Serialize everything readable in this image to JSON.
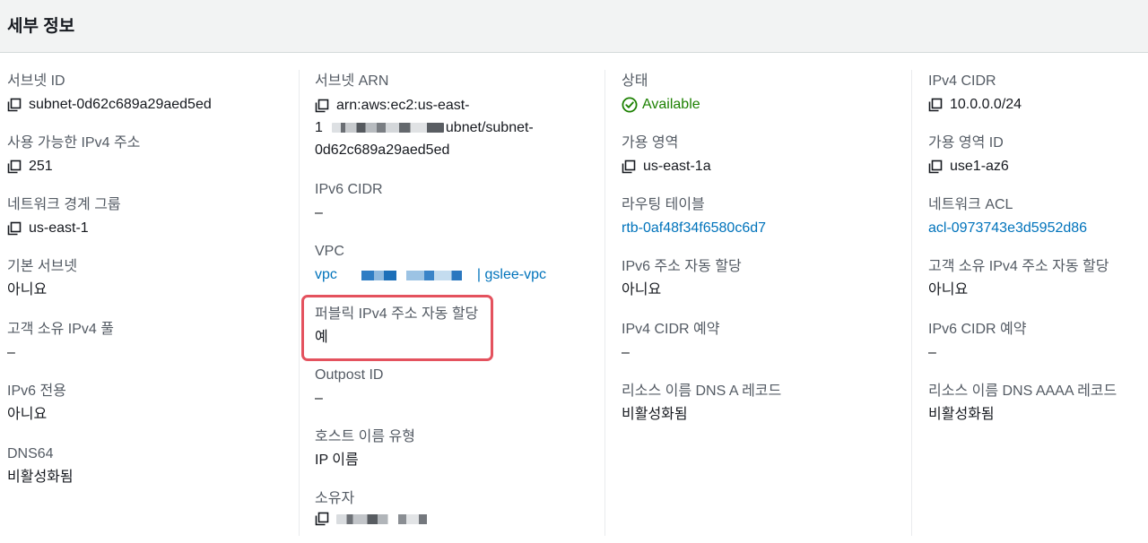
{
  "header": {
    "title": "세부 정보"
  },
  "columns": [
    [
      {
        "key": "subnet_id",
        "label": "서브넷 ID",
        "value": "subnet-0d62c689a29aed5ed",
        "copy": true
      },
      {
        "key": "available_ipv4",
        "label": "사용 가능한 IPv4 주소",
        "value": "251",
        "copy": true
      },
      {
        "key": "network_border_group",
        "label": "네트워크 경계 그룹",
        "value": "us-east-1",
        "copy": true
      },
      {
        "key": "default_subnet",
        "label": "기본 서브넷",
        "value": "아니요"
      },
      {
        "key": "customer_owned_ipv4_pool",
        "label": "고객 소유 IPv4 풀",
        "value": "–"
      },
      {
        "key": "ipv6_only",
        "label": "IPv6 전용",
        "value": "아니요"
      },
      {
        "key": "dns64",
        "label": "DNS64",
        "value": "비활성화됨"
      }
    ],
    [
      {
        "key": "subnet_arn",
        "label": "서브넷 ARN",
        "value_line1": "arn:aws:ec2:us-east-",
        "value_line2_prefix": "1",
        "value_line2_suffix": "ubnet/subnet-",
        "value_line3": "0d62c689a29aed5ed",
        "copy": true
      },
      {
        "key": "ipv6_cidr",
        "label": "IPv6 CIDR",
        "value": "–"
      },
      {
        "key": "vpc",
        "label": "VPC",
        "value_prefix": "vpc",
        "value_suffix": "| gslee-vpc",
        "link": true
      },
      {
        "key": "auto_assign_public_ipv4",
        "label": "퍼블릭 IPv4 주소 자동 할당",
        "value": "예"
      },
      {
        "key": "outpost_id",
        "label": "Outpost ID",
        "value": "–"
      },
      {
        "key": "hostname_type",
        "label": "호스트 이름 유형",
        "value": "IP 이름"
      },
      {
        "key": "owner",
        "label": "소유자",
        "value": "",
        "copy": true
      }
    ],
    [
      {
        "key": "state",
        "label": "상태",
        "value": "Available",
        "status": "ok"
      },
      {
        "key": "availability_zone",
        "label": "가용 영역",
        "value": "us-east-1a",
        "copy": true
      },
      {
        "key": "route_table",
        "label": "라우팅 테이블",
        "value": "rtb-0af48f34f6580c6d7",
        "link": true
      },
      {
        "key": "auto_assign_ipv6",
        "label": "IPv6 주소 자동 할당",
        "value": "아니요"
      },
      {
        "key": "ipv4_cidr_reservation",
        "label": "IPv4 CIDR 예약",
        "value": "–"
      },
      {
        "key": "resource_name_dns_a",
        "label": "리소스 이름 DNS A 레코드",
        "value": "비활성화됨"
      }
    ],
    [
      {
        "key": "ipv4_cidr",
        "label": "IPv4 CIDR",
        "value": "10.0.0.0/24",
        "copy": true
      },
      {
        "key": "availability_zone_id",
        "label": "가용 영역 ID",
        "value": "use1-az6",
        "copy": true
      },
      {
        "key": "network_acl",
        "label": "네트워크 ACL",
        "value": "acl-0973743e3d5952d86",
        "link": true
      },
      {
        "key": "auto_assign_customer_ipv4",
        "label": "고객 소유 IPv4 주소 자동 할당",
        "value": "아니요"
      },
      {
        "key": "ipv6_cidr_reservation",
        "label": "IPv6 CIDR 예약",
        "value": "–"
      },
      {
        "key": "resource_name_dns_aaaa",
        "label": "리소스 이름 DNS AAAA 레코드",
        "value": "비활성화됨"
      }
    ]
  ],
  "colors": {
    "label": "#545b64",
    "value": "#16191f",
    "link": "#0073bb",
    "available": "#1d8102",
    "highlight": "#e4525e"
  },
  "icons": {
    "copy": "copy-icon",
    "status_ok": "status-positive-icon"
  }
}
